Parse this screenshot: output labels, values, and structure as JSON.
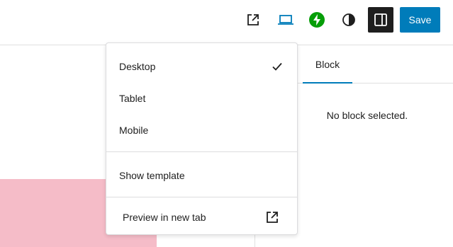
{
  "toolbar": {
    "external_icon": "external-link-icon",
    "device_icon": "laptop-icon",
    "jetpack_icon": "jetpack-bolt-icon",
    "contrast_icon": "contrast-icon",
    "sidebar_icon": "sidebar-toggle-icon",
    "save_label": "Save"
  },
  "settings": {
    "tab_block": "Block",
    "empty_text": "No block selected."
  },
  "menu": {
    "items": [
      {
        "label": "Desktop",
        "checked": true
      },
      {
        "label": "Tablet",
        "checked": false
      },
      {
        "label": "Mobile",
        "checked": false
      }
    ],
    "show_template": "Show template",
    "preview_new_tab": "Preview in new tab"
  },
  "colors": {
    "accent": "#007cba",
    "jetpack_green": "#069e08",
    "dark": "#1e1e1e",
    "pink_block": "#f5bcc8"
  }
}
